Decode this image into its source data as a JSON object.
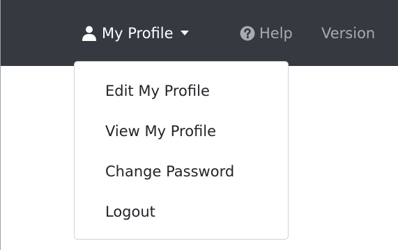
{
  "navbar": {
    "profile_label": "My Profile",
    "profile_icon": "user-icon",
    "caret_icon": "caret-down-icon",
    "help_label": "Help",
    "help_icon": "question-circle-icon",
    "version_label": "Version"
  },
  "dropdown": {
    "items": [
      {
        "label": "Edit My Profile"
      },
      {
        "label": "View My Profile"
      },
      {
        "label": "Change Password"
      },
      {
        "label": "Logout"
      }
    ]
  },
  "colors": {
    "navbar_bg": "#343a40",
    "nav_active_text": "#ffffff",
    "nav_muted_text": "#a6abb0",
    "menu_text": "#212529",
    "menu_border": "#cfd3d7"
  }
}
